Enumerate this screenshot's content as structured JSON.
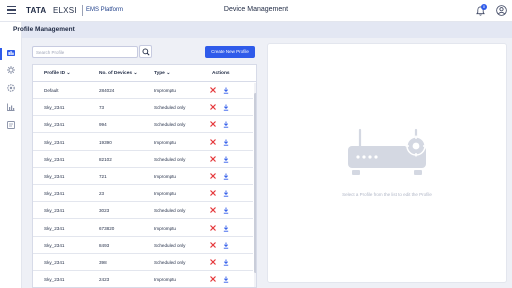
{
  "brand": {
    "name_bold": "TATA",
    "name_light": "ELXSI",
    "platform": "EMS Platform"
  },
  "header": {
    "title": "Device Management",
    "notification_count": "0"
  },
  "sidebar": {
    "items": [
      "dashboard",
      "settings",
      "gear",
      "reports",
      "logs"
    ]
  },
  "page": {
    "title": "Profile Management"
  },
  "search": {
    "placeholder": "Search Profile"
  },
  "toolbar": {
    "create_label": "Create New Profile"
  },
  "table": {
    "columns": [
      "Profile ID",
      "No. of Devices",
      "Type",
      "Actions"
    ],
    "rows": [
      {
        "id": "Default",
        "devices": "284024",
        "type": "Impromptu"
      },
      {
        "id": "Sky_2341",
        "devices": "73",
        "type": "Scheduled only"
      },
      {
        "id": "Sky_2341",
        "devices": "994",
        "type": "Scheduled only"
      },
      {
        "id": "Sky_2341",
        "devices": "19390",
        "type": "Impromptu"
      },
      {
        "id": "Sky_2341",
        "devices": "82102",
        "type": "Scheduled only"
      },
      {
        "id": "Sky_2341",
        "devices": "721",
        "type": "Impromptu"
      },
      {
        "id": "Sky_2341",
        "devices": "23",
        "type": "Impromptu"
      },
      {
        "id": "Sky_2341",
        "devices": "3023",
        "type": "Scheduled only"
      },
      {
        "id": "Sky_2341",
        "devices": "673820",
        "type": "Impromptu"
      },
      {
        "id": "Sky_2341",
        "devices": "8493",
        "type": "Scheduled only"
      },
      {
        "id": "Sky_2341",
        "devices": "398",
        "type": "Scheduled only"
      },
      {
        "id": "Sky_2341",
        "devices": "2423",
        "type": "Impromptu"
      }
    ]
  },
  "detail": {
    "empty_hint": "Select a Profile from the list to edit the Profile"
  },
  "colors": {
    "accent": "#2f5bea",
    "delete": "#e5383b",
    "download": "#2f5bea"
  }
}
